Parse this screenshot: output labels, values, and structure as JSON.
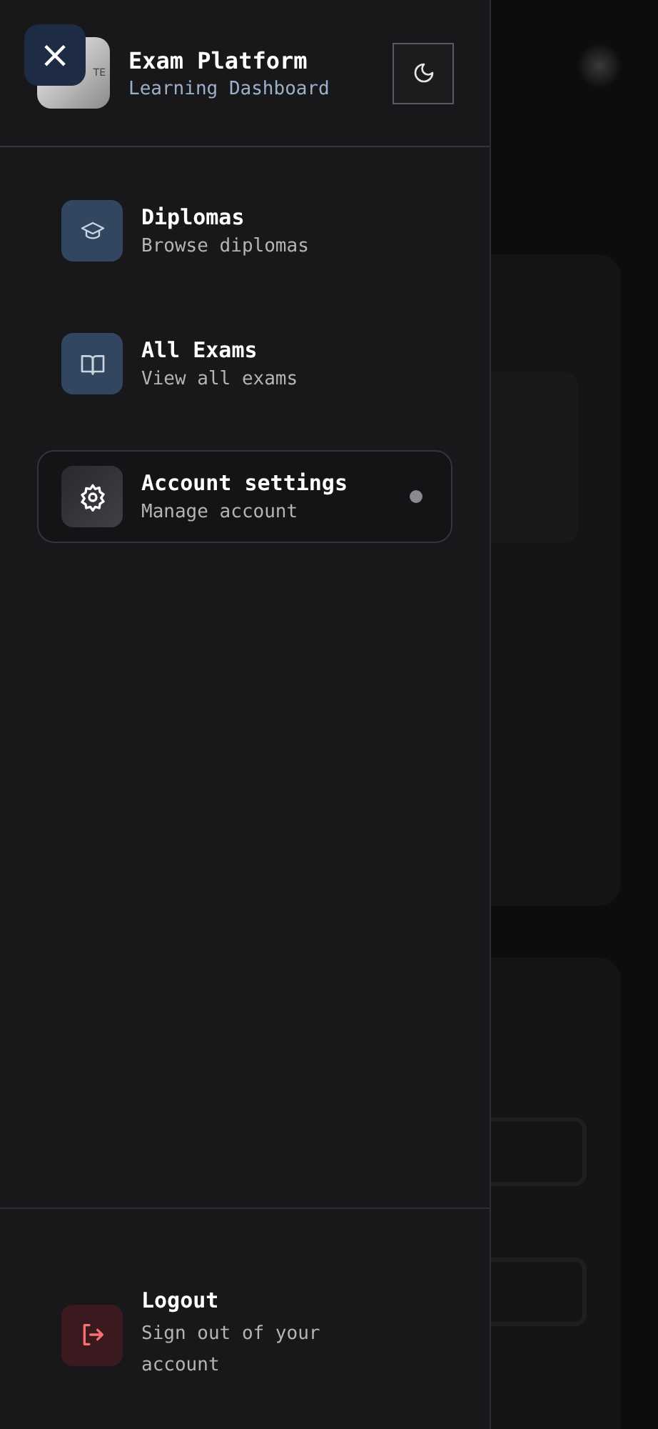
{
  "header": {
    "logo_text": "TE",
    "title": "Exam Platform",
    "subtitle": "Learning Dashboard",
    "close_label": "×"
  },
  "nav": [
    {
      "title": "Diplomas",
      "subtitle": "Browse diplomas",
      "selected": false
    },
    {
      "title": "All Exams",
      "subtitle": "View all exams",
      "selected": false
    },
    {
      "title": "Account settings",
      "subtitle": "Manage account",
      "selected": true
    }
  ],
  "logout": {
    "title": "Logout",
    "subtitle": "Sign out of your account"
  }
}
